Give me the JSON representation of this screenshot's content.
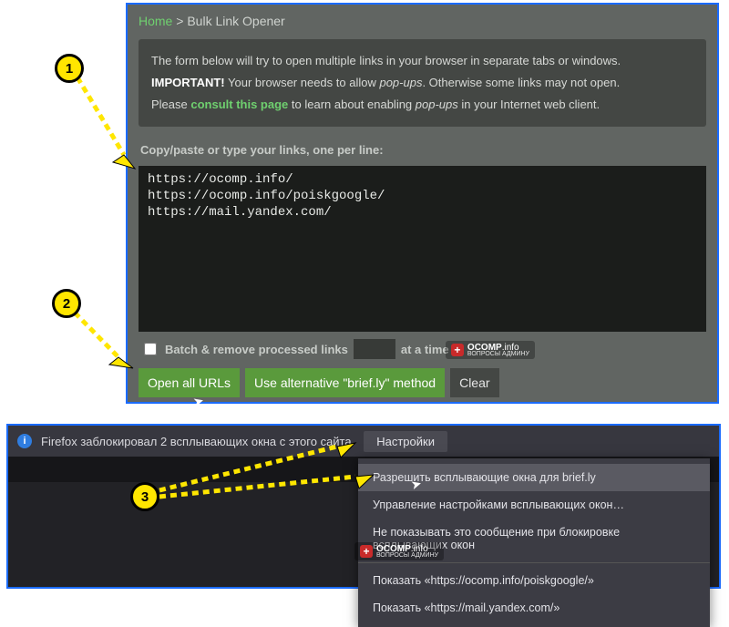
{
  "breadcrumb": {
    "home": "Home",
    "sep": " > ",
    "current": "Bulk Link Opener"
  },
  "info": {
    "line1": "The form below will try to open multiple links in your browser in separate tabs or windows.",
    "imp_label": "IMPORTANT!",
    "imp_rest_a": " Your browser needs to allow ",
    "imp_em": "pop-ups",
    "imp_rest_b": ". Otherwise some links may not open.",
    "please_a": "Please ",
    "consult": "consult this page",
    "please_b": " to learn about enabling ",
    "please_em": "pop-ups",
    "please_c": " in your Internet web client."
  },
  "section_label": "Copy/paste or type your links, one per line:",
  "urls": "https://ocomp.info/\nhttps://ocomp.info/poiskgoogle/\nhttps://mail.yandex.com/",
  "batch": {
    "label_a": "Batch & remove processed links",
    "label_b": "at a time"
  },
  "buttons": {
    "open": "Open all URLs",
    "alt": "Use alternative \"brief.ly\" method",
    "clear": "Clear"
  },
  "watermark": {
    "brand": "OCOMP",
    "tld": ".info",
    "sub": "ВОПРОСЫ АДМИНУ"
  },
  "fx": {
    "msg": "Firefox заблокировал 2 всплывающих окна с этого сайта.",
    "opts": "Настройки",
    "allow": "Разрешить всплывающие окна для brief.ly",
    "manage": "Управление настройками всплывающих окон…",
    "dont": "Не показывать это сообщение при блокировке всплывающих окон",
    "show1": "Показать «https://ocomp.info/poiskgoogle/»",
    "show2": "Показать «https://mail.yandex.com/»"
  },
  "badges": {
    "n1": "1",
    "n2": "2",
    "n3": "3"
  }
}
